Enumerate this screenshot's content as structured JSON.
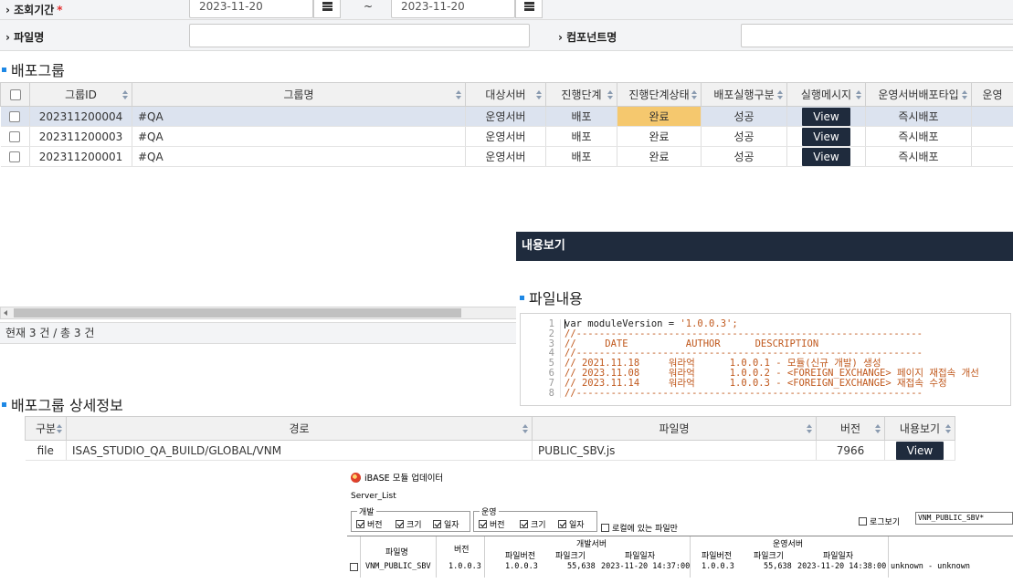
{
  "search": {
    "period_label": "조회기간",
    "required_mark": "*",
    "date_from": "2023-11-20",
    "date_to": "2023-11-20",
    "range_sep": "~",
    "file_label": "파일명",
    "file_value": "",
    "component_label": "컴포넌트명",
    "component_value": ""
  },
  "group_section": {
    "title": "배포그룹",
    "columns": [
      "그룹ID",
      "그룹명",
      "대상서버",
      "진행단계",
      "진행단계상태",
      "배포실행구분",
      "실행메시지",
      "운영서버배포타입",
      "운영"
    ],
    "rows": [
      {
        "group_id": "202311200004",
        "group_name": "#QA",
        "server": "운영서버",
        "stage": "배포",
        "stage_status": "완료",
        "exec_type": "성공",
        "message": "View",
        "deploy_type": "즉시배포",
        "selected": true
      },
      {
        "group_id": "202311200003",
        "group_name": "#QA",
        "server": "운영서버",
        "stage": "배포",
        "stage_status": "완료",
        "exec_type": "성공",
        "message": "View",
        "deploy_type": "즉시배포",
        "selected": false
      },
      {
        "group_id": "202311200001",
        "group_name": "#QA",
        "server": "운영서버",
        "stage": "배포",
        "stage_status": "완료",
        "exec_type": "성공",
        "message": "View",
        "deploy_type": "즉시배포",
        "selected": false
      }
    ],
    "footer": "현재 3 건 / 총 3 건"
  },
  "detail_section": {
    "title": "배포그룹 상세정보",
    "columns": [
      "구분",
      "경로",
      "파일명",
      "버전",
      "내용보기"
    ],
    "rows": [
      {
        "kind": "file",
        "path": "ISAS_STUDIO_QA_BUILD/GLOBAL/VNM",
        "file_name": "PUBLIC_SBV.js",
        "version": "7966",
        "view": "View"
      }
    ]
  },
  "content_view": {
    "title": "내용보기",
    "section_title": "파일내용",
    "lines": [
      {
        "no": "1",
        "text": "ar moduleVersion = ",
        "str": "'1.0.0.3';"
      },
      {
        "no": "2",
        "text": "//------------------------------------------------------------"
      },
      {
        "no": "3",
        "text": "//     DATE          AUTHOR      DESCRIPTION"
      },
      {
        "no": "4",
        "text": "//------------------------------------------------------------"
      },
      {
        "no": "5",
        "text": "// 2021.11.18     워라억      1.0.0.1 - 모듈(신규 개발) 생성"
      },
      {
        "no": "6",
        "text": "// 2023.11.08     워라억      1.0.0.2 - <FOREIGN_EXCHANGE> 페이지 재접속 개선"
      },
      {
        "no": "7",
        "text": "// 2023.11.14     워라억      1.0.0.3 - <FOREIGN_EXCHANGE> 재접속 수정"
      },
      {
        "no": "8",
        "text": "//------------------------------------------------------------"
      }
    ]
  },
  "updater": {
    "title": "iBASE 모듈 업데이터",
    "server_list": "Server_List",
    "dev_group": "개발",
    "ops_group": "운영",
    "opt_version": "버전",
    "opt_size": "크기",
    "opt_date": "일자",
    "only_existing": "로컬에 있는 파일만",
    "log_view": "로그보기",
    "log_value": "VNM_PUBLIC_SBV*",
    "headers": {
      "file_name": "파일명",
      "version": "버전",
      "dev_server": "개발서버",
      "ops_server": "운영서버",
      "file_version": "파일버전",
      "file_size": "파일크기",
      "file_date": "파일일자"
    },
    "row": {
      "file_name": "VNM_PUBLIC_SBV",
      "version": "1.0.0.3",
      "dev_version": "1.0.0.3",
      "dev_size": "55,638",
      "dev_date": "2023-11-20 14:37:00",
      "ops_version": "1.0.0.3",
      "ops_size": "55,638",
      "ops_date": "2023-11-20 14:38:00",
      "status": "unknown - unknown"
    }
  }
}
